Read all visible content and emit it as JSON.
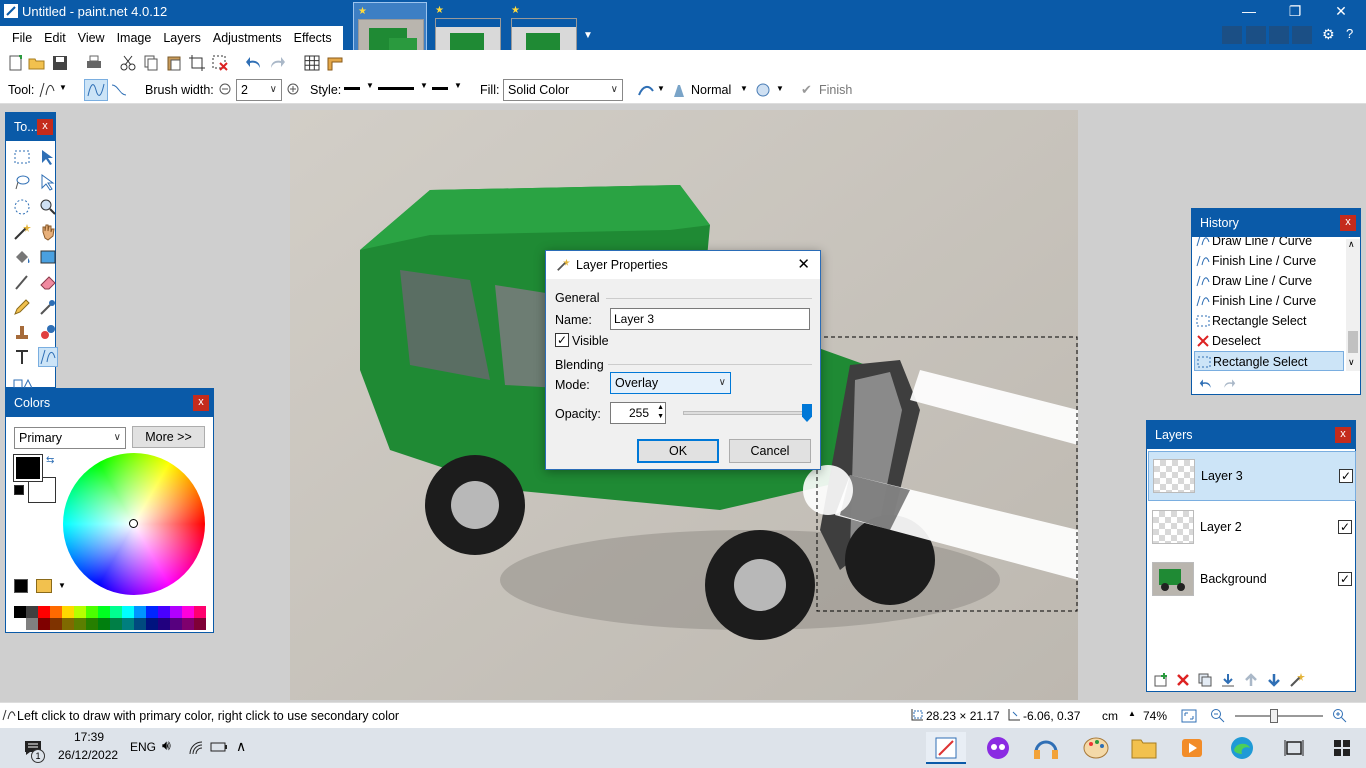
{
  "window": {
    "title": "Untitled - paint.net 4.0.12",
    "minimize": "—",
    "restore": "❐",
    "close": "✕"
  },
  "menu": [
    "File",
    "Edit",
    "View",
    "Image",
    "Layers",
    "Adjustments",
    "Effects"
  ],
  "toolbar": {
    "tool_label": "Tool:",
    "brush_width_label": "Brush width:",
    "brush_width_value": "2",
    "style_label": "Style:",
    "fill_label": "Fill:",
    "fill_value": "Solid Color",
    "blend_mode": "Normal",
    "finish_label": "Finish"
  },
  "tools_panel": {
    "title": "To..."
  },
  "colors_panel": {
    "title": "Colors",
    "selector": "Primary",
    "more_button": "More >>"
  },
  "history_panel": {
    "title": "History",
    "items": [
      "Draw Line / Curve",
      "Finish Line / Curve",
      "Draw Line / Curve",
      "Finish Line / Curve",
      "Rectangle Select",
      "Deselect",
      "Rectangle Select"
    ]
  },
  "layers_panel": {
    "title": "Layers",
    "layers": [
      {
        "name": "Layer 3",
        "visible": true,
        "selected": true
      },
      {
        "name": "Layer 2",
        "visible": true,
        "selected": false
      },
      {
        "name": "Background",
        "visible": true,
        "selected": false
      }
    ]
  },
  "dialog": {
    "title": "Layer Properties",
    "general_label": "General",
    "name_label": "Name:",
    "name_value": "Layer 3",
    "visible_label": "Visible",
    "blending_label": "Blending",
    "mode_label": "Mode:",
    "mode_value": "Overlay",
    "opacity_label": "Opacity:",
    "opacity_value": "255",
    "opacity_fraction": 1.0,
    "ok_label": "OK",
    "cancel_label": "Cancel"
  },
  "statusbar": {
    "hint": "Left click to draw with primary color, right click to use secondary color",
    "selection_size": "28.23 × 21.17",
    "cursor_pos": "-6.06, 0.37",
    "units": "cm",
    "zoom": "74%"
  },
  "taskbar": {
    "time": "17:39",
    "date": "26/12/2022",
    "lang": "ENG",
    "notification_count": "1"
  },
  "colors": {
    "accent": "#0a5aa8",
    "selected_row": "#cce4f7",
    "ok_border": "#0078d7"
  }
}
